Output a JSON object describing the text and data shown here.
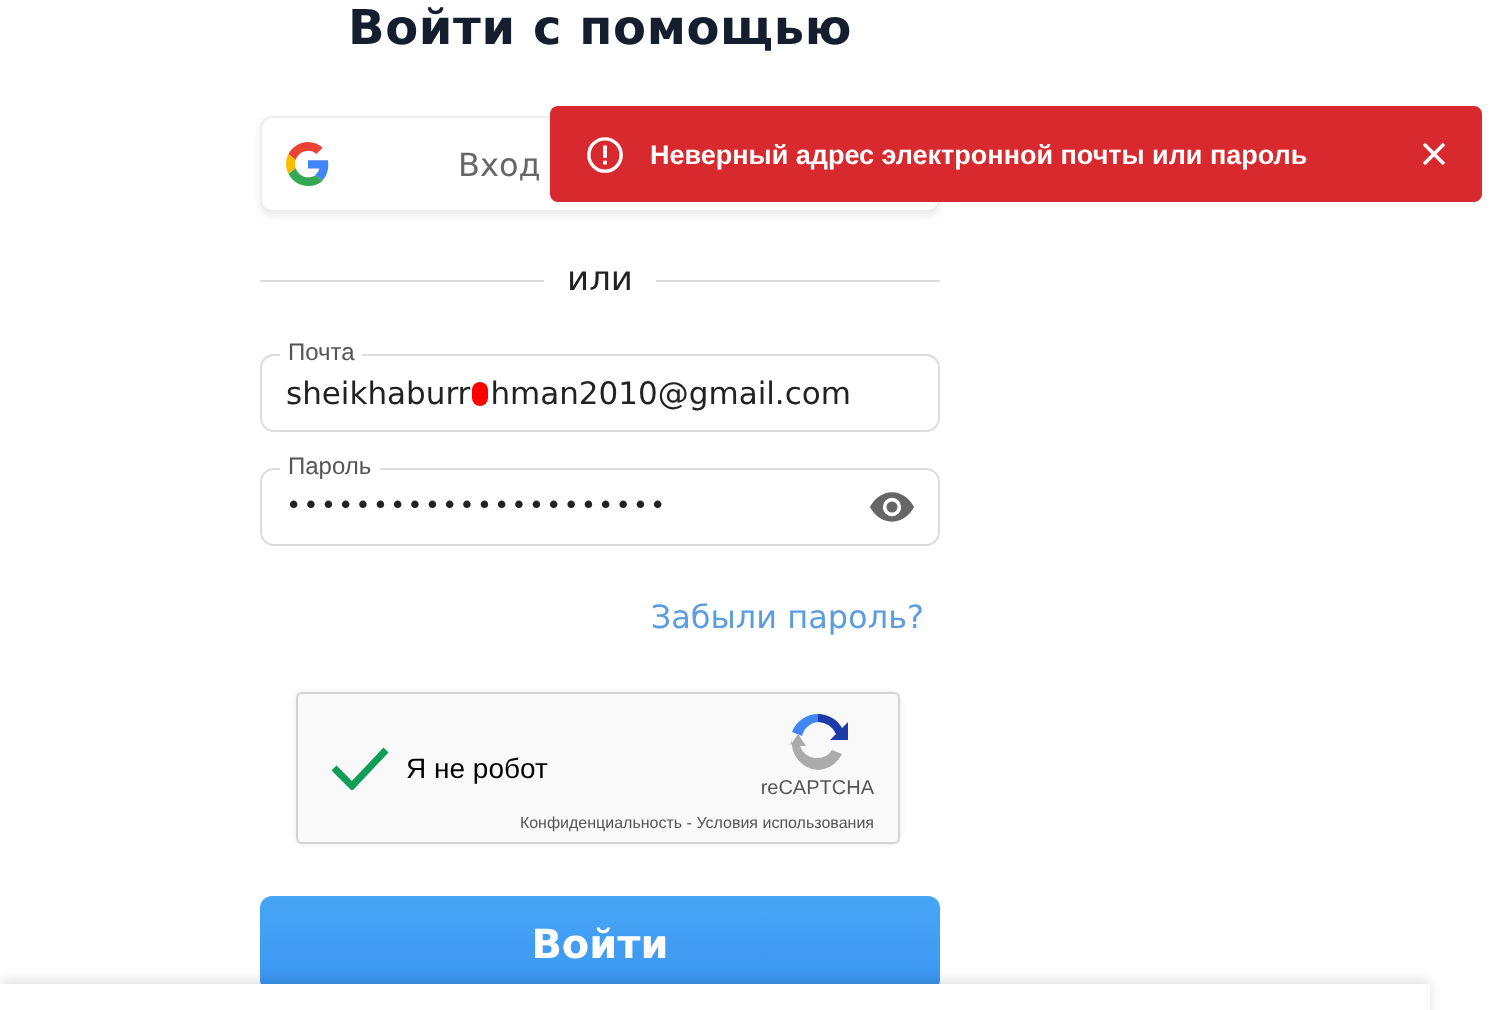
{
  "heading": "Войти с помощью",
  "google_button": {
    "label": "Вход"
  },
  "divider": "или",
  "email": {
    "label": "Почта",
    "value_before": "sheikhaburr",
    "value_after": "hman2010@gmail.com"
  },
  "password": {
    "label": "Пароль",
    "value": "••••••••••••••••••••••"
  },
  "forgot_link": "Забыли пароль?",
  "captcha": {
    "label": "Я не робот",
    "checked": true,
    "brand": "reCAPTCHA",
    "links": "Конфиденциальность - Условия использования"
  },
  "submit": "Войти",
  "toast": {
    "message": "Неверный адрес электронной почты или пароль"
  }
}
